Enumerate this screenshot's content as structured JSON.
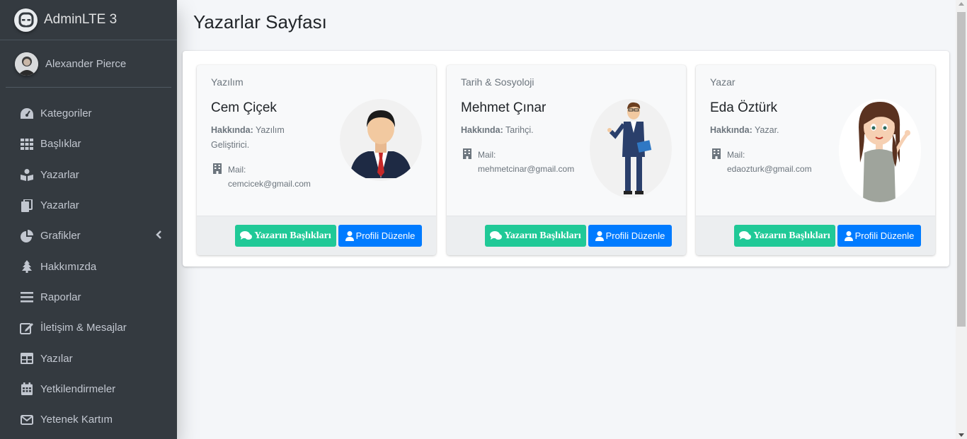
{
  "brand": {
    "name": "AdminLTE 3"
  },
  "user": {
    "name": "Alexander Pierce"
  },
  "sidebar": {
    "items": [
      {
        "label": "Kategoriler",
        "icon": "tachometer-icon"
      },
      {
        "label": "Başlıklar",
        "icon": "th-icon"
      },
      {
        "label": "Yazarlar",
        "icon": "book-reader-icon"
      },
      {
        "label": "Yazarlar",
        "icon": "copy-icon"
      },
      {
        "label": "Grafikler",
        "icon": "chart-pie-icon",
        "has_arrow": true
      },
      {
        "label": "Hakkımızda",
        "icon": "tree-icon"
      },
      {
        "label": "Raporlar",
        "icon": "bars-icon"
      },
      {
        "label": "İletişim & Mesajlar",
        "icon": "edit-icon"
      },
      {
        "label": "Yazılar",
        "icon": "table-icon"
      },
      {
        "label": "Yetkilendirmeler",
        "icon": "calendar-icon"
      },
      {
        "label": "Yetenek Kartım",
        "icon": "envelope-icon"
      }
    ]
  },
  "page": {
    "title": "Yazarlar Sayfası"
  },
  "authors": [
    {
      "category": "Yazılım",
      "name": "Cem Çiçek",
      "about_label": "Hakkında:",
      "about": "Yazılım Geliştirici.",
      "mail_label": "Mail:",
      "mail": "cemcicek@gmail.com",
      "headlines_button": "Yazarın Başlıkları",
      "edit_button": "Profili Düzenle"
    },
    {
      "category": "Tarih & Sosyoloji",
      "name": "Mehmet Çınar",
      "about_label": "Hakkında:",
      "about": "Tarihçi.",
      "mail_label": "Mail:",
      "mail": "mehmetcinar@gmail.com",
      "headlines_button": "Yazarın Başlıkları",
      "edit_button": "Profili Düzenle"
    },
    {
      "category": "Yazar",
      "name": "Eda Öztürk",
      "about_label": "Hakkında:",
      "about": "Yazar.",
      "mail_label": "Mail:",
      "mail": "edaozturk@gmail.com",
      "headlines_button": "Yazarın Başlıkları",
      "edit_button": "Profili Düzenle"
    }
  ],
  "colors": {
    "sidebar": "#343a40",
    "accent_green": "#20c997",
    "accent_blue": "#007bff",
    "background": "#f4f6f9"
  }
}
